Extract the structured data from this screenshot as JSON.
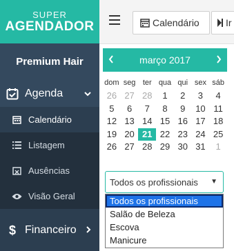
{
  "logo": {
    "line1": "SUPER",
    "line2": "AGENDADOR"
  },
  "salon_name": "Premium Hair",
  "menu": {
    "agenda": {
      "label": "Agenda"
    },
    "submenu": [
      {
        "label": "Calendário",
        "icon": "calendar-icon",
        "active": true
      },
      {
        "label": "Listagem",
        "icon": "list-icon",
        "active": false
      },
      {
        "label": "Ausências",
        "icon": "calendar-x-icon",
        "active": false
      },
      {
        "label": "Visão Geral",
        "icon": "eye-icon",
        "active": false
      }
    ],
    "financeiro": {
      "label": "Financeiro"
    }
  },
  "topbar": {
    "calendar_label": "Calendário",
    "next_label": "Ir"
  },
  "calendar": {
    "month_label": "março 2017",
    "weekdays": [
      "dom",
      "seg",
      "ter",
      "qua",
      "qui",
      "sex",
      "sáb"
    ],
    "weeks": [
      [
        {
          "d": "26",
          "m": true
        },
        {
          "d": "27",
          "m": true
        },
        {
          "d": "28",
          "m": true
        },
        {
          "d": "1"
        },
        {
          "d": "2"
        },
        {
          "d": "3"
        },
        {
          "d": "4"
        }
      ],
      [
        {
          "d": "5"
        },
        {
          "d": "6"
        },
        {
          "d": "7"
        },
        {
          "d": "8"
        },
        {
          "d": "9"
        },
        {
          "d": "10"
        },
        {
          "d": "11"
        }
      ],
      [
        {
          "d": "12"
        },
        {
          "d": "13"
        },
        {
          "d": "14"
        },
        {
          "d": "15"
        },
        {
          "d": "16"
        },
        {
          "d": "17"
        },
        {
          "d": "18"
        }
      ],
      [
        {
          "d": "19"
        },
        {
          "d": "20"
        },
        {
          "d": "21",
          "t": true
        },
        {
          "d": "22"
        },
        {
          "d": "23"
        },
        {
          "d": "24"
        },
        {
          "d": "25"
        }
      ],
      [
        {
          "d": "26"
        },
        {
          "d": "27"
        },
        {
          "d": "28"
        },
        {
          "d": "29"
        },
        {
          "d": "30"
        },
        {
          "d": "31"
        },
        {
          "d": "1",
          "m": true
        }
      ]
    ]
  },
  "professional_select": {
    "value": "Todos os profissionais",
    "options": [
      "Todos os profissionais",
      "Salão de Beleza",
      "Escova",
      "Manicure"
    ],
    "selected_index": 0
  },
  "colors": {
    "accent": "#25b9a4",
    "sidebar": "#2c3e50",
    "highlight": "#1e73e8"
  }
}
